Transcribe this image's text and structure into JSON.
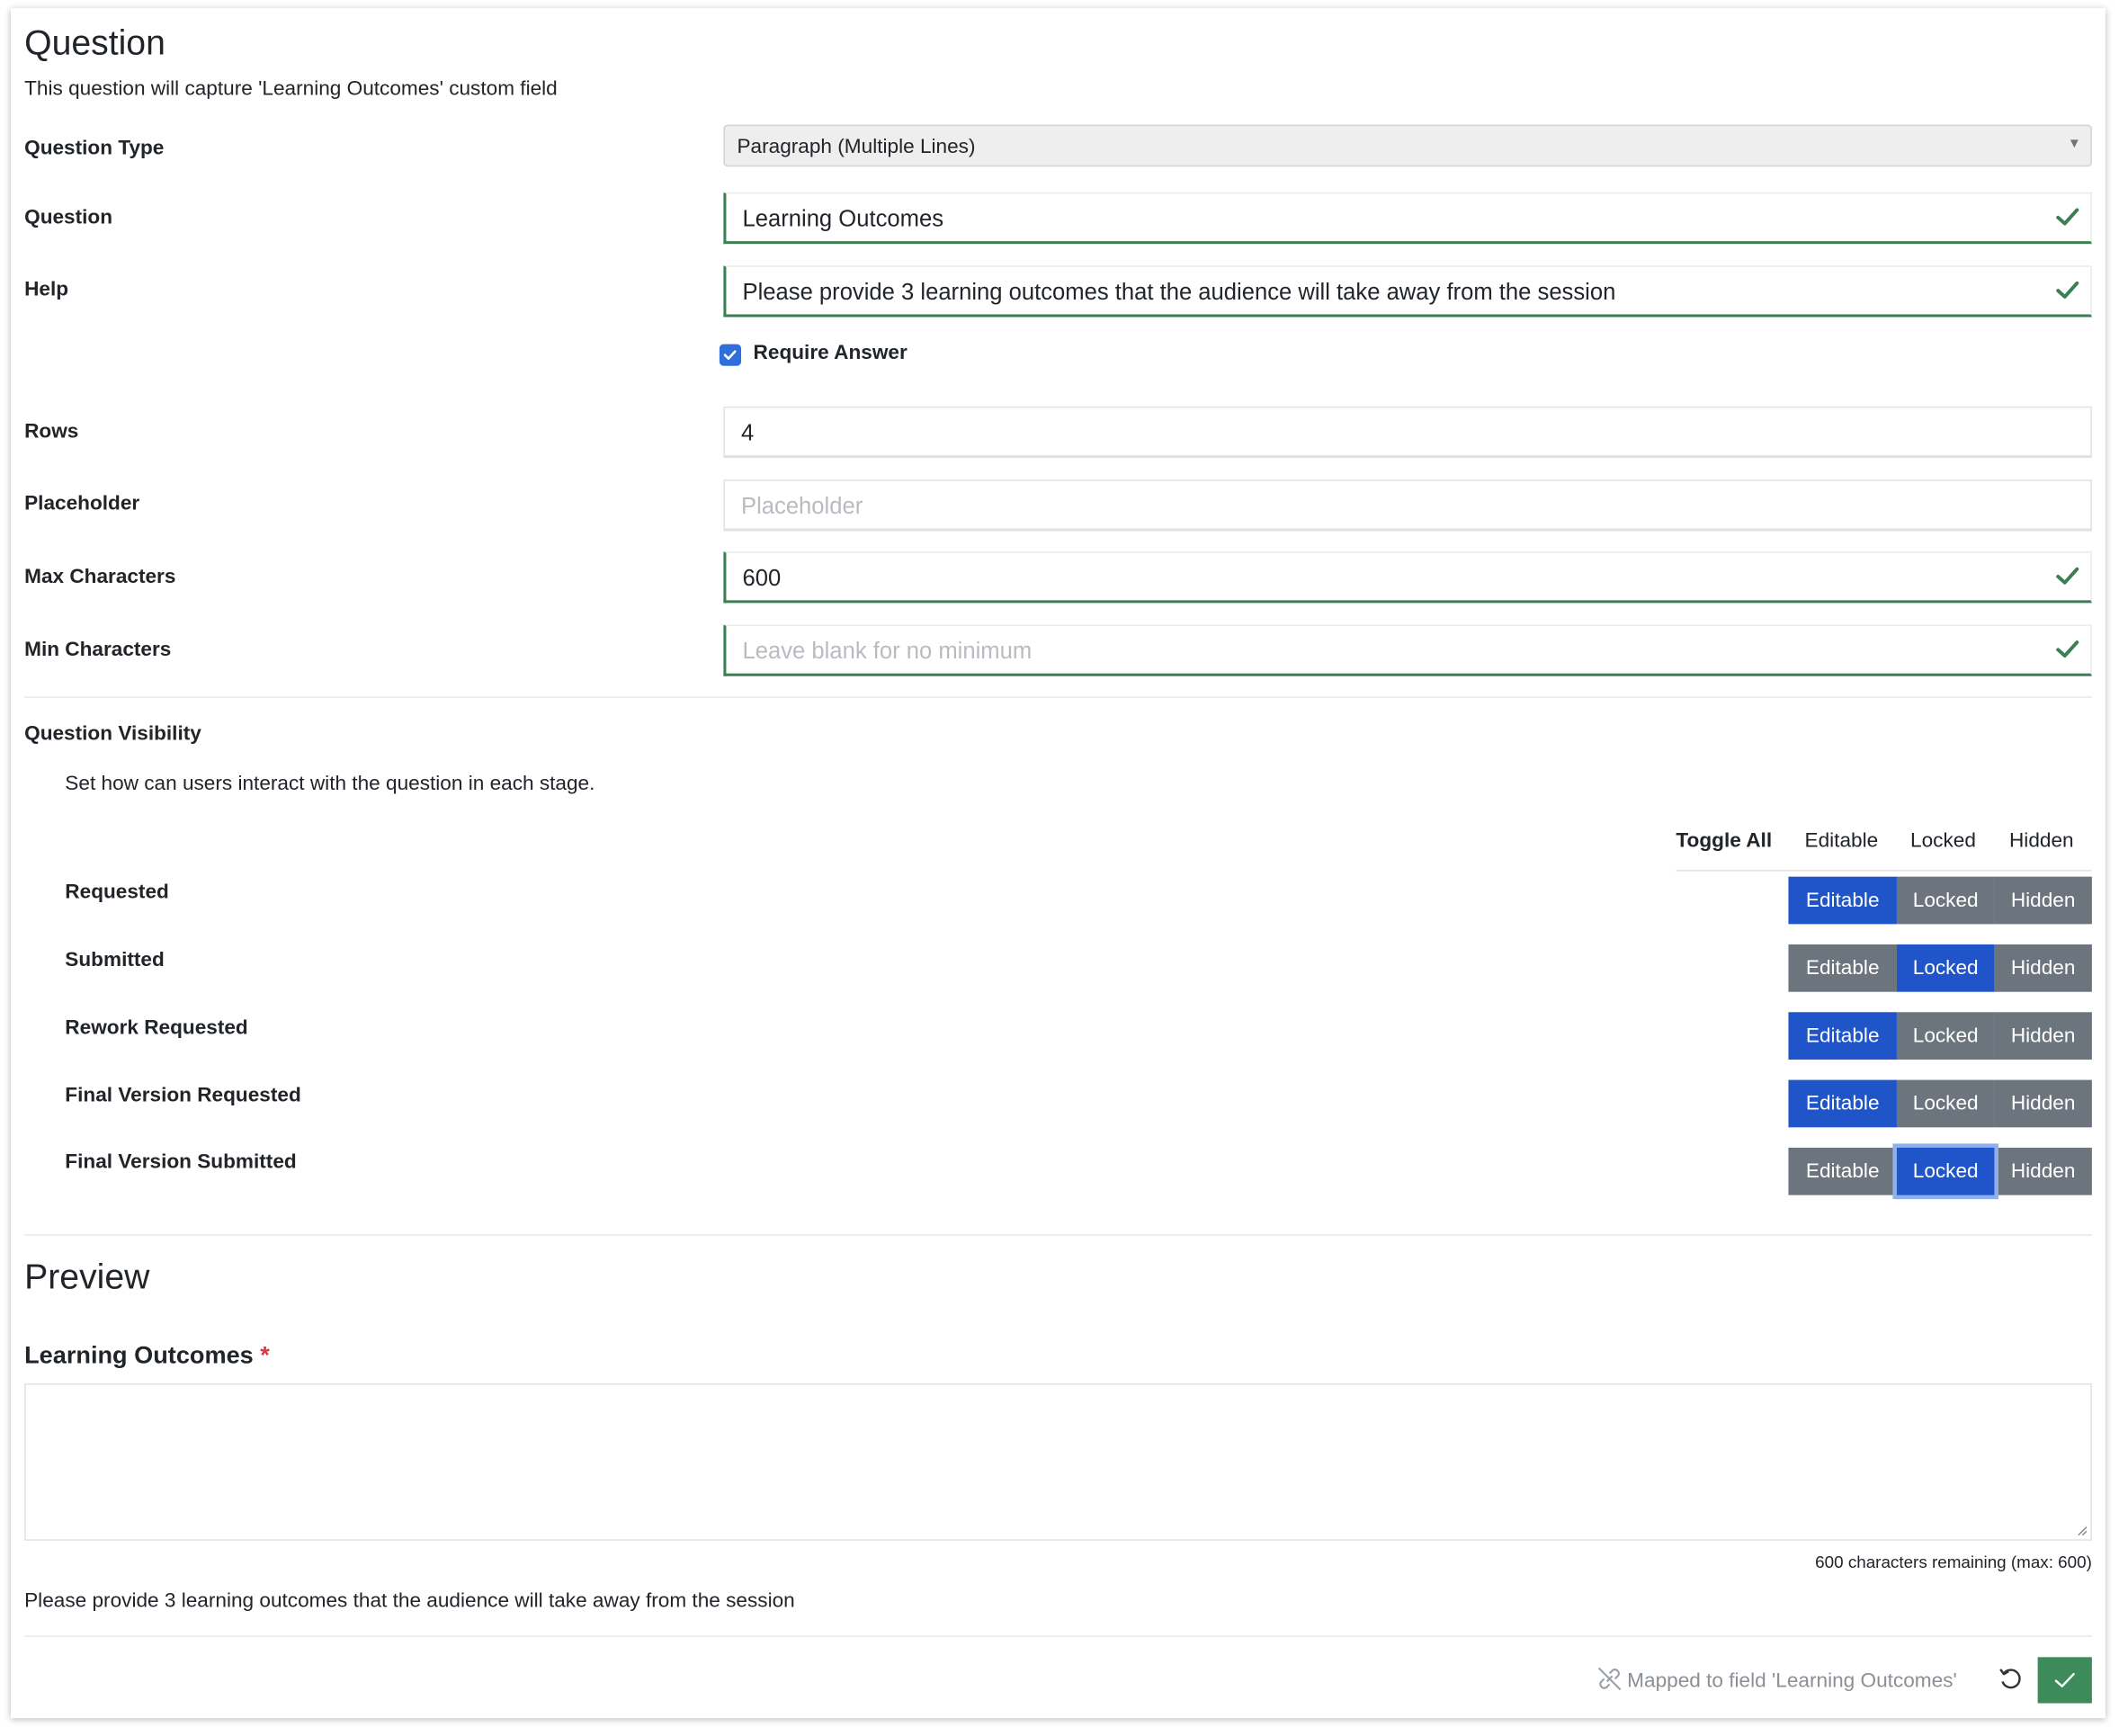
{
  "header": {
    "title": "Question",
    "subtitle": "This question will capture 'Learning Outcomes' custom field"
  },
  "form": {
    "question_type": {
      "label": "Question Type",
      "value": "Paragraph (Multiple Lines)"
    },
    "question": {
      "label": "Question",
      "value": "Learning Outcomes"
    },
    "help": {
      "label": "Help",
      "value": "Please provide 3 learning outcomes that the audience will take away from the session"
    },
    "require_answer": {
      "label": "Require Answer",
      "checked": true
    },
    "rows": {
      "label": "Rows",
      "value": "4"
    },
    "placeholder": {
      "label": "Placeholder",
      "value": "",
      "placeholder": "Placeholder"
    },
    "max_characters": {
      "label": "Max Characters",
      "value": "600"
    },
    "min_characters": {
      "label": "Min Characters",
      "value": "",
      "placeholder": "Leave blank for no minimum"
    }
  },
  "visibility": {
    "title": "Question Visibility",
    "description": "Set how can users interact with the question in each stage.",
    "toggle_all": {
      "label": "Toggle All",
      "options": [
        "Editable",
        "Locked",
        "Hidden"
      ]
    },
    "stages": [
      {
        "name": "Requested",
        "selected": "Editable"
      },
      {
        "name": "Submitted",
        "selected": "Locked"
      },
      {
        "name": "Rework Requested",
        "selected": "Editable"
      },
      {
        "name": "Final Version Requested",
        "selected": "Editable"
      },
      {
        "name": "Final Version Submitted",
        "selected": "Locked"
      }
    ],
    "options": {
      "editable": "Editable",
      "locked": "Locked",
      "hidden": "Hidden"
    }
  },
  "preview": {
    "title": "Preview",
    "field_label": "Learning Outcomes",
    "required_mark": "*",
    "char_counter": "600 characters remaining (max: 600)",
    "help_text": "Please provide 3 learning outcomes that the audience will take away from the session"
  },
  "footer": {
    "mapped_text": "Mapped to field 'Learning Outcomes'",
    "icons": [
      "unlink-icon",
      "undo-icon",
      "check-icon"
    ]
  },
  "colors": {
    "valid_green": "#3a7f52",
    "selected_blue": "#1f55c8",
    "unselected_gray": "#6c757d",
    "required_red": "#dc3545",
    "save_green": "#3d8b5a"
  }
}
